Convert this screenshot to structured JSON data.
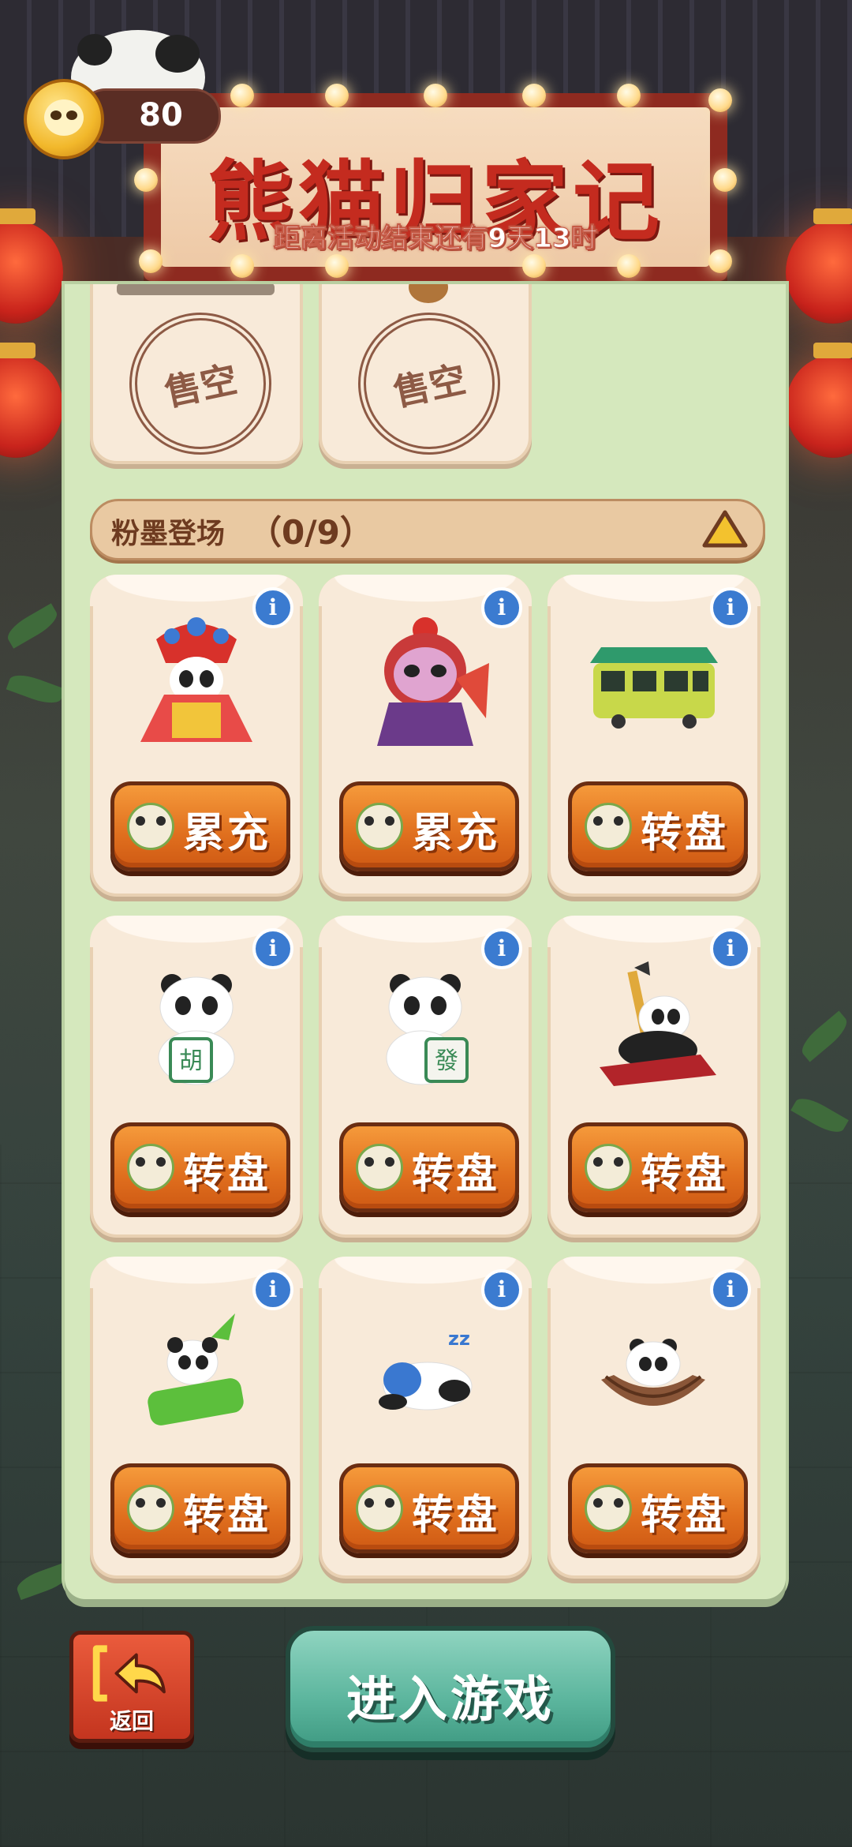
{
  "header": {
    "title": "熊猫归家记",
    "countdown": "距离活动结束还有9天13时"
  },
  "currency": {
    "value": "80",
    "icon": "panda-coin-icon"
  },
  "sold_out_items": [
    {
      "stamp": "售空"
    },
    {
      "stamp": "售空"
    }
  ],
  "section": {
    "title": "粉墨登场",
    "count": "（0/9）",
    "icon": "warning-triangle-icon"
  },
  "items": [
    {
      "name": "opera-panda-queen",
      "button": "累充"
    },
    {
      "name": "opera-panda-mask",
      "button": "累充"
    },
    {
      "name": "green-tram",
      "button": "转盘"
    },
    {
      "name": "panda-hu-tile",
      "button": "转盘"
    },
    {
      "name": "panda-fa-tile",
      "button": "转盘"
    },
    {
      "name": "panda-calligraphy",
      "button": "转盘"
    },
    {
      "name": "panda-bamboo",
      "button": "转盘"
    },
    {
      "name": "panda-sleeping",
      "button": "转盘"
    },
    {
      "name": "panda-basket",
      "button": "转盘"
    }
  ],
  "info_icon_glyph": "i",
  "bottom": {
    "back_label": "返回",
    "enter_label": "进入游戏"
  }
}
